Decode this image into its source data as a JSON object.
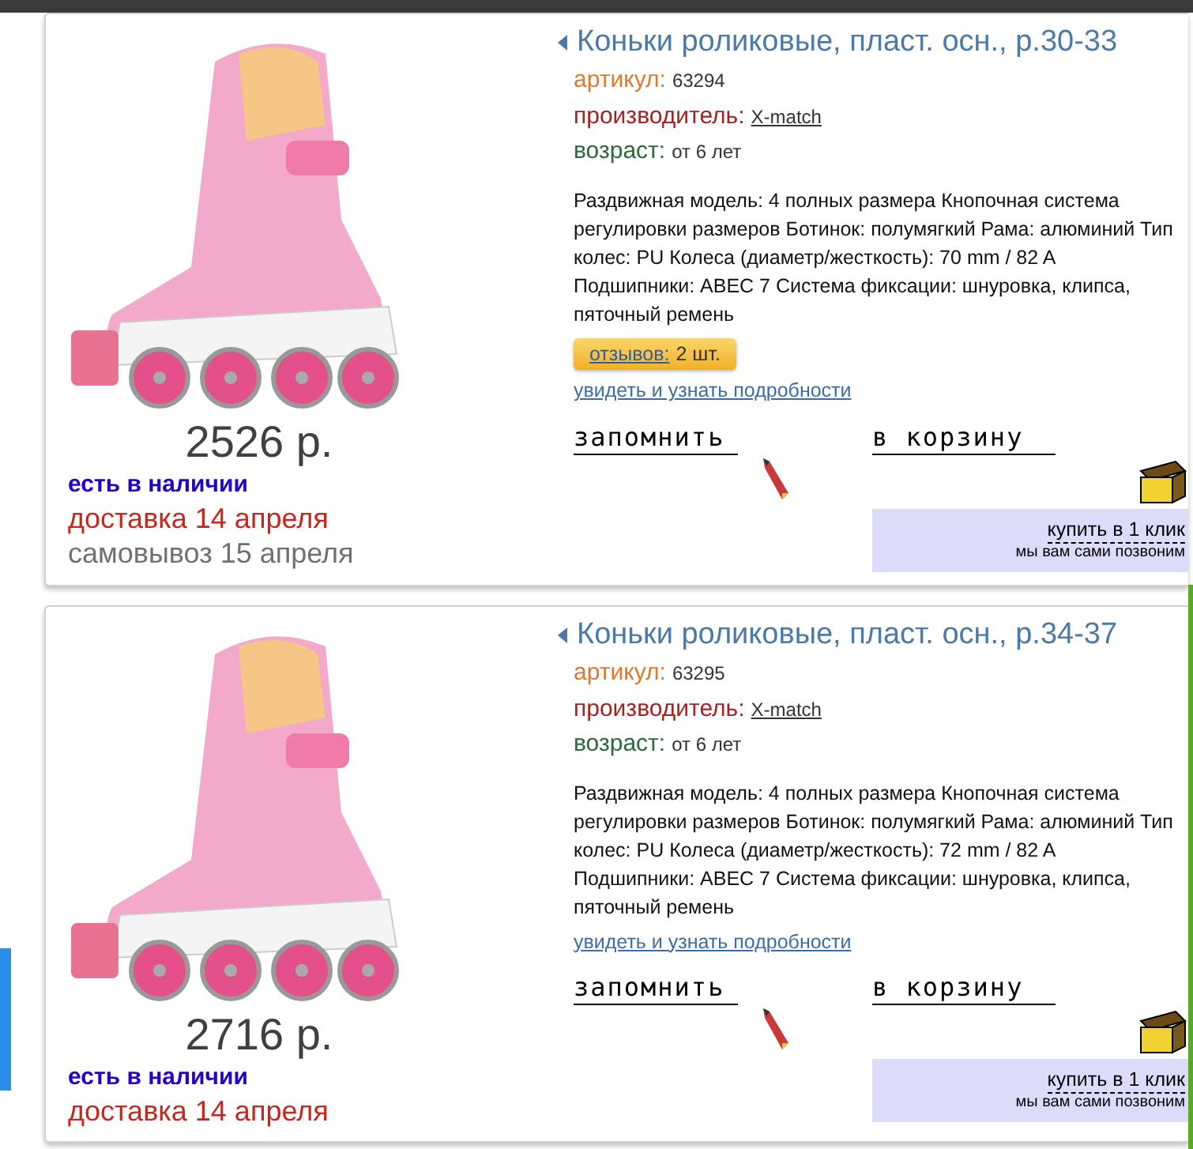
{
  "products": [
    {
      "title": "Коньки роликовые, пласт. осн., р.30-33",
      "article_label": "артикул:",
      "article": "63294",
      "maker_label": "производитель:",
      "maker": "X-match",
      "age_label": "возраст:",
      "age": "от 6 лет",
      "description": "Раздвижная модель: 4 полных размера Кнопочная система регулировки размеров Ботинок: полумягкий Рама: алюминий Тип колес: PU Колеса (диаметр/жесткость): 70 mm / 82 A Подшипники: ABEC 7 Система фиксации: шнуровка, клипса, пяточный ремень",
      "reviews": {
        "label": "отзывов:",
        "count": "2 шт."
      },
      "details_link": "увидеть и узнать подробности",
      "remember": "запомнить",
      "cart": "в корзину",
      "one_click": "купить в 1 клик",
      "one_click_note": "мы вам сами позвоним",
      "price": "2526 р.",
      "availability": [
        {
          "kind": "stock",
          "text": "есть в наличии"
        },
        {
          "kind": "delivery",
          "text": "доставка 14 апреля"
        },
        {
          "kind": "pickup",
          "text": "самовывоз 15 апреля"
        }
      ]
    },
    {
      "title": "Коньки роликовые, пласт. осн., р.34-37",
      "article_label": "артикул:",
      "article": "63295",
      "maker_label": "производитель:",
      "maker": "X-match",
      "age_label": "возраст:",
      "age": "от 6 лет",
      "description": "Раздвижная модель: 4 полных размера Кнопочная система регулировки размеров Ботинок: полумягкий Рама: алюминий Тип колес: PU Колеса (диаметр/жесткость): 72 mm / 82 A Подшипники: ABEC 7 Система фиксации: шнуровка, клипса, пяточный ремень",
      "details_link": "увидеть и узнать подробности",
      "remember": "запомнить",
      "cart": "в корзину",
      "one_click": "купить в 1 клик",
      "one_click_note": "мы вам сами позвоним",
      "price": "2716 р.",
      "availability": [
        {
          "kind": "stock",
          "text": "есть в наличии"
        },
        {
          "kind": "delivery",
          "text": "доставка 14 апреля"
        }
      ]
    }
  ]
}
